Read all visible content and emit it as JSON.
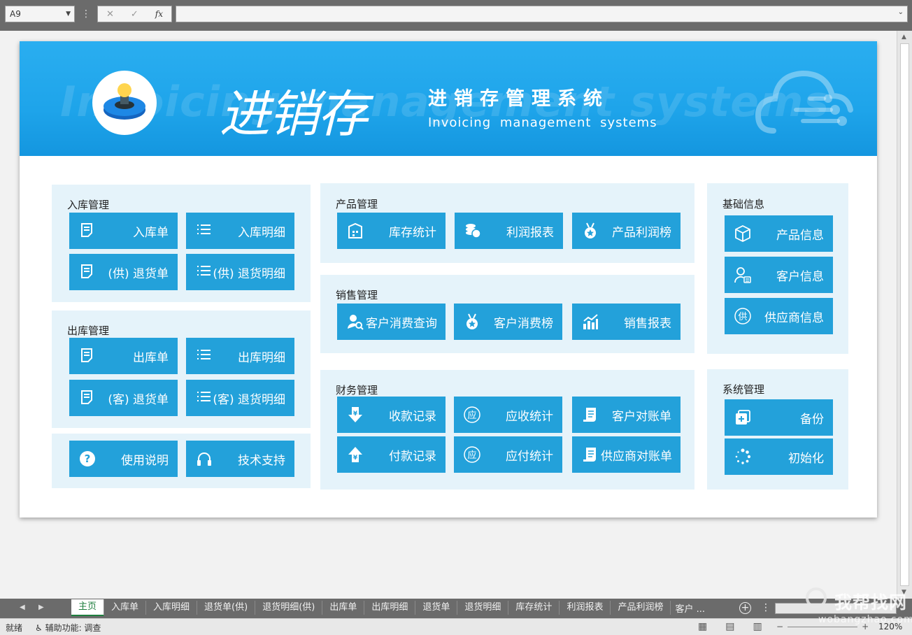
{
  "formula_bar": {
    "name_box": "A9",
    "cancel_glyph": "✕",
    "enter_glyph": "✓",
    "fx_label": "fx",
    "formula": ""
  },
  "banner": {
    "watermark": "Invoicing management systems",
    "title": "进销存",
    "system_name_cn": "进销存管理系统",
    "system_name_en": "Invoicing management systems"
  },
  "panels": {
    "inbound": {
      "title": "入库管理",
      "tiles": [
        "入库单",
        "入库明细",
        "(供) 退货单",
        "(供) 退货明细"
      ]
    },
    "outbound": {
      "title": "出库管理",
      "tiles": [
        "出库单",
        "出库明细",
        "(客) 退货单",
        "(客) 退货明细"
      ]
    },
    "help": {
      "tiles": [
        "使用说明",
        "技术支持"
      ]
    },
    "product": {
      "title": "产品管理",
      "tiles": [
        "库存统计",
        "利润报表",
        "产品利润榜"
      ]
    },
    "sales": {
      "title": "销售管理",
      "tiles": [
        "客户消费查询",
        "客户消费榜",
        "销售报表"
      ]
    },
    "finance": {
      "title": "财务管理",
      "tiles": [
        "收款记录",
        "应收统计",
        "客户对账单",
        "付款记录",
        "应付统计",
        "供应商对账单"
      ]
    },
    "basic": {
      "title": "基础信息",
      "tiles": [
        "产品信息",
        "客户信息",
        "供应商信息"
      ]
    },
    "system": {
      "title": "系统管理",
      "tiles": [
        "备份",
        "初始化"
      ]
    }
  },
  "sheet_tabs": [
    "主页",
    "入库单",
    "入库明细",
    "退货单(供)",
    "退货明细(供)",
    "出库单",
    "出库明细",
    "退货单",
    "退货明细",
    "库存统计",
    "利润报表",
    "产品利润榜"
  ],
  "sheet_tabs_more": "客户 ...",
  "active_tab": "主页",
  "status": {
    "ready": "就绪",
    "accessibility": "辅助功能: 调查",
    "zoom": "120%"
  },
  "site_watermark": {
    "cn": "我帮找网",
    "en": "wobangzhao.com"
  },
  "colors": {
    "tile": "#23a1da",
    "panel": "#e5f3fa",
    "banner": "#1ea4ea"
  }
}
